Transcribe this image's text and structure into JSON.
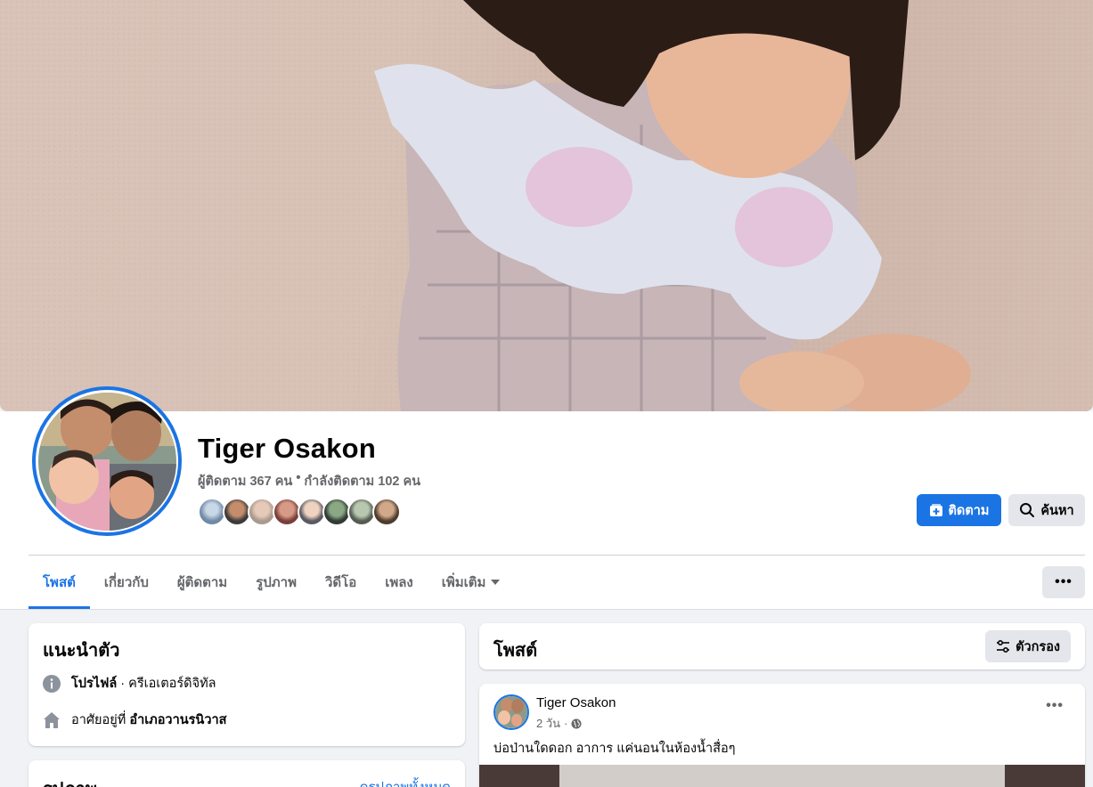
{
  "profile": {
    "name": "Tiger Osakon",
    "followers": "ผู้ติดตาม 367 คน",
    "separator": "•",
    "following": "กำลังติดตาม 102 คน"
  },
  "buttons": {
    "follow": "ติดตาม",
    "search": "ค้นหา",
    "more": "•••"
  },
  "tabs": [
    {
      "label": "โพสต์",
      "active": true
    },
    {
      "label": "เกี่ยวกับ"
    },
    {
      "label": "ผู้ติดตาม"
    },
    {
      "label": "รูปภาพ"
    },
    {
      "label": "วิดีโอ"
    },
    {
      "label": "เพลง"
    },
    {
      "label": "เพิ่มเติม"
    }
  ],
  "intro": {
    "title": "แนะนำตัว",
    "profile_label": "โปรไฟล์",
    "profile_sep": "·",
    "profile_category": "ครีเอเตอร์ดิจิทัล",
    "lives_prefix": "อาศัยอยู่ที่",
    "lives_place": "อำเภอวานรนิวาส"
  },
  "photos": {
    "title": "รูปภาพ",
    "see_all": "ดูรูปภาพทั้งหมด"
  },
  "posts": {
    "title": "โพสต์",
    "filter": "ตัวกรอง"
  },
  "post": {
    "author": "Tiger Osakon",
    "time": "2 วัน",
    "dot": "·",
    "privacy_icon": "globe-icon",
    "text": "บ่อป่านใดดอก อาการ แค่นอนในห้องน้ำสื่อๆ",
    "more": "•••"
  },
  "colors": {
    "accent": "#1b74e4",
    "secondary_text": "#65676b",
    "background": "#f0f2f5"
  }
}
